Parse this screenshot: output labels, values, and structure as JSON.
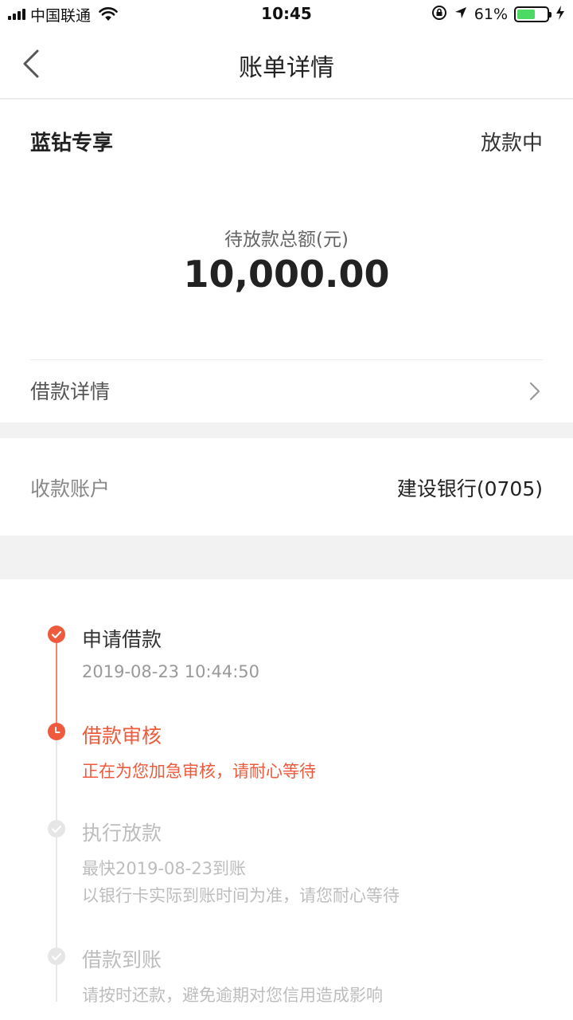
{
  "status_bar": {
    "carrier": "中国联通",
    "time": "10:45",
    "battery_percent": "61%",
    "battery_level": 0.61,
    "battery_color": "#4cd964"
  },
  "nav": {
    "title": "账单详情",
    "back_icon": "chevron-left-icon"
  },
  "summary": {
    "product_name": "蓝钻专享",
    "status": "放款中",
    "amount_label": "待放款总额(元)",
    "amount_value": "10,000.00",
    "detail_link_label": "借款详情"
  },
  "account": {
    "label": "收款账户",
    "value": "建设银行(0705)"
  },
  "timeline": {
    "accent_color": "#f05a3c",
    "steps": [
      {
        "title": "申请借款",
        "lines": [
          "2019-08-23 10:44:50"
        ],
        "state": "done",
        "icon": "check-circle-icon"
      },
      {
        "title": "借款审核",
        "lines": [
          "正在为您加急审核，请耐心等待"
        ],
        "state": "current",
        "icon": "clock-circle-icon"
      },
      {
        "title": "执行放款",
        "lines": [
          "最快2019-08-23到账",
          "以银行卡实际到账时间为准，请您耐心等待"
        ],
        "state": "pending",
        "icon": "check-circle-icon"
      },
      {
        "title": "借款到账",
        "lines": [
          "请按时还款，避免逾期对您信用造成影响"
        ],
        "state": "pending",
        "icon": "check-circle-icon"
      }
    ]
  }
}
